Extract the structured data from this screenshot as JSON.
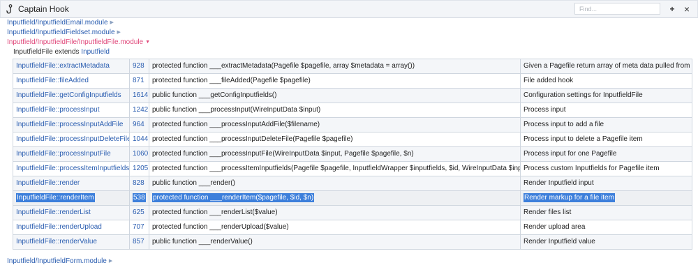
{
  "app": {
    "title": "Captain Hook"
  },
  "search": {
    "placeholder": "Find..."
  },
  "toolbar": {
    "add_label": "+",
    "close_label": "×"
  },
  "modules_before": [
    {
      "label": "Inputfield/InputfieldEmail.module",
      "expanded": false
    },
    {
      "label": "Inputfield/InputfieldFieldset.module",
      "expanded": false
    },
    {
      "label": "Inputfield/InputfieldFile/InputfieldFile.module",
      "expanded": true
    }
  ],
  "extends_line": {
    "class_name": "InputfieldFile",
    "word": "extends",
    "parent": "Inputfield"
  },
  "hooks": [
    {
      "name": "InputfieldFile::extractMetadata",
      "line": "928",
      "signature": "protected function ___extractMetadata(Pagefile $pagefile, array $metadata = array())",
      "description": "Given a Pagefile return array of meta data pulled from it"
    },
    {
      "name": "InputfieldFile::fileAdded",
      "line": "871",
      "signature": "protected function ___fileAdded(Pagefile $pagefile)",
      "description": "File added hook"
    },
    {
      "name": "InputfieldFile::getConfigInputfields",
      "line": "1614",
      "signature": "public function ___getConfigInputfields()",
      "description": "Configuration settings for InputfieldFile"
    },
    {
      "name": "InputfieldFile::processInput",
      "line": "1242",
      "signature": "public function ___processInput(WireInputData $input)",
      "description": "Process input"
    },
    {
      "name": "InputfieldFile::processInputAddFile",
      "line": "964",
      "signature": "protected function ___processInputAddFile($filename)",
      "description": "Process input to add a file"
    },
    {
      "name": "InputfieldFile::processInputDeleteFile",
      "line": "1044",
      "signature": "protected function ___processInputDeleteFile(Pagefile $pagefile)",
      "description": "Process input to delete a Pagefile item"
    },
    {
      "name": "InputfieldFile::processInputFile",
      "line": "1060",
      "signature": "protected function ___processInputFile(WireInputData $input, Pagefile $pagefile, $n)",
      "description": "Process input for one Pagefile"
    },
    {
      "name": "InputfieldFile::processItemInputfields",
      "line": "1205",
      "signature": "protected function ___processItemInputfields(Pagefile $pagefile, InputfieldWrapper $inputfields, $id, WireInputData $input)",
      "description": "Process custom Inputfields for Pagefile item"
    },
    {
      "name": "InputfieldFile::render",
      "line": "828",
      "signature": "public function ___render()",
      "description": "Render Inputfield input"
    },
    {
      "name": "InputfieldFile::renderItem",
      "line": "538",
      "signature": "protected function ___renderItem($pagefile, $id, $n)",
      "description": "Render markup for a file item"
    },
    {
      "name": "InputfieldFile::renderList",
      "line": "625",
      "signature": "protected function ___renderList($value)",
      "description": "Render files list"
    },
    {
      "name": "InputfieldFile::renderUpload",
      "line": "707",
      "signature": "protected function ___renderUpload($value)",
      "description": "Render upload area"
    },
    {
      "name": "InputfieldFile::renderValue",
      "line": "857",
      "signature": "public function ___renderValue()",
      "description": "Render Inputfield value"
    }
  ],
  "modules_after": [
    {
      "label": "Inputfield/InputfieldForm.module",
      "expanded": false
    }
  ]
}
